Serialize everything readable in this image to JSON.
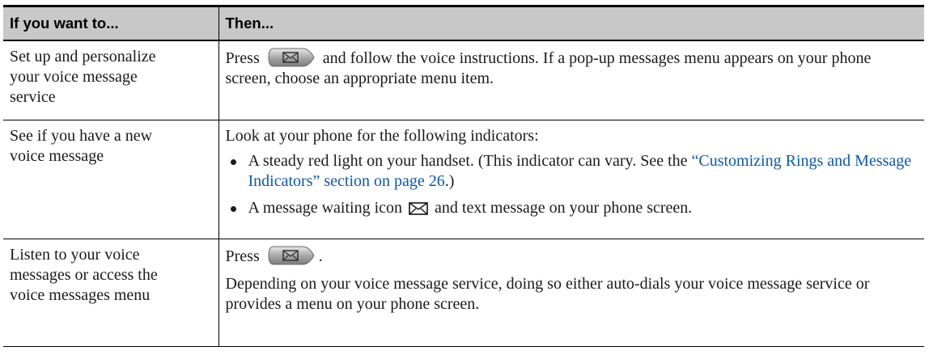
{
  "header": {
    "col1": "If you want to...",
    "col2": "Then..."
  },
  "rows": [
    {
      "want": "Set up and personalize your voice message service",
      "then_pre": "Press",
      "then_post": "and follow the voice instructions. If a pop-up messages menu appears on your phone screen, choose an appropriate menu item."
    },
    {
      "want": "See if you have a new voice message",
      "intro": "Look at your phone for the following indicators:",
      "bullet1_pre": "A steady red light on your handset. (This indicator can vary. See the ",
      "bullet1_link": "“Customizing Rings and Message Indicators” section on page 26",
      "bullet1_post": ".)",
      "bullet2_pre": "A message waiting icon",
      "bullet2_post": "and text message on your phone screen."
    },
    {
      "want": "Listen to your voice messages or access the voice messages menu",
      "then_pre": "Press",
      "then_post": ".",
      "detail": "Depending on your voice message service, doing so either auto-dials your voice message service or provides a menu on your phone screen."
    }
  ],
  "colors": {
    "header_bg": "#c8c8c8",
    "link": "#0e57a6",
    "button": "#9a9a9a"
  },
  "icons": [
    "messages-button-icon",
    "message-waiting-icon"
  ]
}
